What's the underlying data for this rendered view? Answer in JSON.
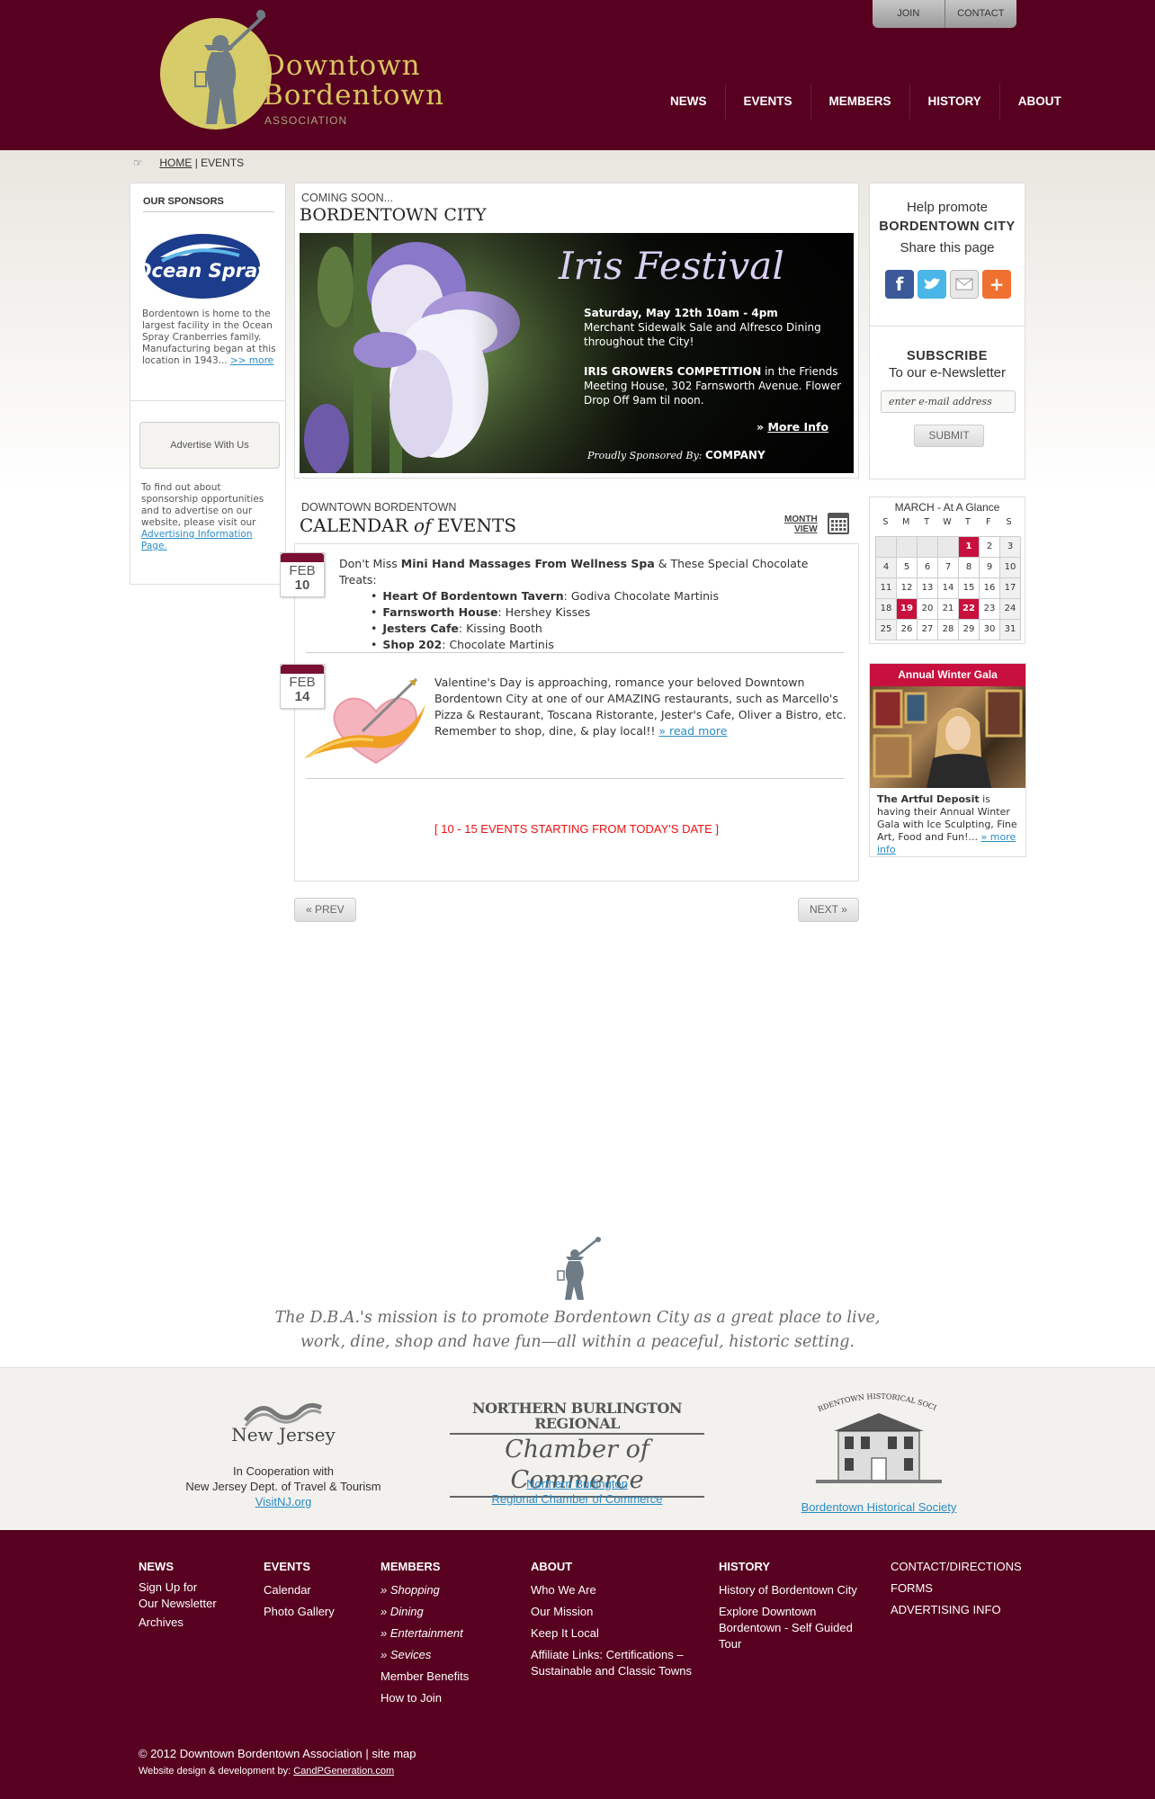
{
  "header": {
    "logo_line1": "Downtown",
    "logo_line2": "Bordentown",
    "logo_assoc": "ASSOCIATION",
    "top_buttons": [
      "JOIN",
      "CONTACT"
    ],
    "nav": [
      "NEWS",
      "EVENTS",
      "MEMBERS",
      "HISTORY",
      "ABOUT"
    ],
    "brand_color": "#57001f"
  },
  "breadcrumb": {
    "home": "HOME",
    "sep": "|",
    "current": "EVENTS"
  },
  "left_sidebar": {
    "sponsors_title": "OUR SPONSORS",
    "sponsor_logo_text": "Ocean Spray",
    "sponsor_text": "Bordentown is home to the largest facility in the Ocean Spray Cranberries family. Manufacturing began at this location in 1943...",
    "sponsor_more": ">> more",
    "advertise_button": "Advertise With Us",
    "advertise_text": "To find out about sponsorship opportunities and to advertise on our website, please visit our",
    "advertise_link": "Advertising Information Page."
  },
  "feature": {
    "coming_soon": "COMING SOON...",
    "title": "BORDENTOWN CITY",
    "banner_title": "Iris Festival",
    "banner_date": "Saturday, May 12th 10am - 4pm",
    "banner_desc": "Merchant Sidewalk Sale and Alfresco Dining throughout the City!",
    "banner_comp_bold": "IRIS GROWERS COMPETITION",
    "banner_comp_rest": "in the Friends Meeting House, 302 Farnsworth Avenue. Flower Drop Off 9am til noon.",
    "banner_more": "More Info",
    "banner_sponsor_prefix": "Proudly Sponsored By:",
    "banner_sponsor_name": "COMPANY"
  },
  "calendar": {
    "super": "DOWNTOWN BORDENTOWN",
    "title_pre": "CALENDAR",
    "title_of": "of",
    "title_post": "EVENTS",
    "month_view_1": "MONTH",
    "month_view_2": "VIEW",
    "events": [
      {
        "month": "FEB",
        "day": "10",
        "intro_pre": "Don't Miss",
        "intro_bold": "Mini Hand Massages From Wellness Spa",
        "intro_post": "& These Special Chocolate Treats:",
        "items": [
          {
            "name": "Heart Of Bordentown Tavern",
            "treat": ": Godiva Chocolate Martinis"
          },
          {
            "name": "Farnsworth House",
            "treat": ": Hershey Kisses"
          },
          {
            "name": "Jesters Cafe",
            "treat": ": Kissing Booth"
          },
          {
            "name": "Shop 202",
            "treat": ": Chocolate Martinis"
          }
        ]
      },
      {
        "month": "FEB",
        "day": "14",
        "text": "Valentine's Day is approaching, romance your beloved Downtown Bordentown City at one of our AMAZING restaurants, such as Marcello's Pizza & Restaurant, Toscana Ristorante, Jester's Cafe, Oliver a Bistro, etc. Remember to shop, dine, & play local!!",
        "read_more": "» read more"
      }
    ],
    "count_text": "[ 10 - 15 EVENTS STARTING FROM TODAY'S DATE ]",
    "prev": "« PREV",
    "next": "NEXT »"
  },
  "right_sidebar": {
    "help": "Help promote",
    "city": "BORDENTOWN CITY",
    "share": "Share this page",
    "icons": [
      "facebook-icon",
      "twitter-icon",
      "email-icon",
      "add-icon"
    ],
    "subscribe_title": "SUBSCRIBE",
    "subscribe_sub": "To our e-Newsletter",
    "email_placeholder": "enter e-mail address",
    "submit": "SUBMIT"
  },
  "mini_calendar": {
    "title": "MARCH -  At A Glance",
    "dow": [
      "S",
      "M",
      "T",
      "W",
      "T",
      "F",
      "S"
    ],
    "days": [
      "",
      "",
      "",
      "",
      "1",
      "2",
      "3",
      "4",
      "5",
      "6",
      "7",
      "8",
      "9",
      "10",
      "11",
      "12",
      "13",
      "14",
      "15",
      "16",
      "17",
      "18",
      "19",
      "20",
      "21",
      "22",
      "23",
      "24",
      "25",
      "26",
      "27",
      "28",
      "29",
      "30",
      "31"
    ],
    "highlighted": [
      "1",
      "19",
      "22"
    ],
    "highlight_color": "#c8103e"
  },
  "gala": {
    "title": "Annual Winter Gala",
    "bold": "The Artful Deposit",
    "text": "is having their Annual Winter Gala with Ice Sculpting, Fine Art, Food and Fun!...",
    "more": "» more info"
  },
  "mission": {
    "text": "The D.B.A.'s mission is to promote Bordentown City as a great place to live, work, dine, shop and have fun—all within a peaceful, historic setting."
  },
  "partners": {
    "nj_logo": "New Jersey",
    "nj_line1": "In Cooperation with",
    "nj_line2": "New Jersey Dept. of Travel & Tourism",
    "nj_link": "VisitNJ.org",
    "chamber_logo1": "NORTHERN BURLINGTON REGIONAL",
    "chamber_logo2": "Chamber of Commerce",
    "chamber_link1": "Northern Burlington",
    "chamber_link2": "Regional Chamber of Commerce",
    "hist_logo": "BORDENTOWN HISTORICAL SOCIETY",
    "hist_link": "Bordentown Historical Society"
  },
  "footer": {
    "news": {
      "title": "NEWS",
      "links": [
        "Sign Up for",
        "Our Newsletter",
        "Archives"
      ]
    },
    "events": {
      "title": "EVENTS",
      "links": [
        "Calendar",
        "Photo Gallery"
      ]
    },
    "members": {
      "title": "MEMBERS",
      "italic_links": [
        "Shopping",
        "Dining",
        "Entertainment",
        "Sevices"
      ],
      "links": [
        "Member Benefits",
        "How to Join"
      ]
    },
    "about": {
      "title": "ABOUT",
      "links": [
        "Who We Are",
        "Our Mission",
        "Keep It Local",
        "Affiliate Links: Certifications – Sustainable and Classic Towns"
      ]
    },
    "history": {
      "title": "HISTORY",
      "links": [
        "History of Bordentown City",
        "Explore Downtown Bordentown - Self Guided Tour"
      ]
    },
    "contact": {
      "links": [
        "CONTACT/DIRECTIONS",
        "FORMS",
        "ADVERTISING INFO"
      ]
    },
    "copyright": "© 2012 Downtown Bordentown Association  |  site map",
    "credit_pre": "Website design & development by:",
    "credit_link": "CandPGeneration.com"
  }
}
